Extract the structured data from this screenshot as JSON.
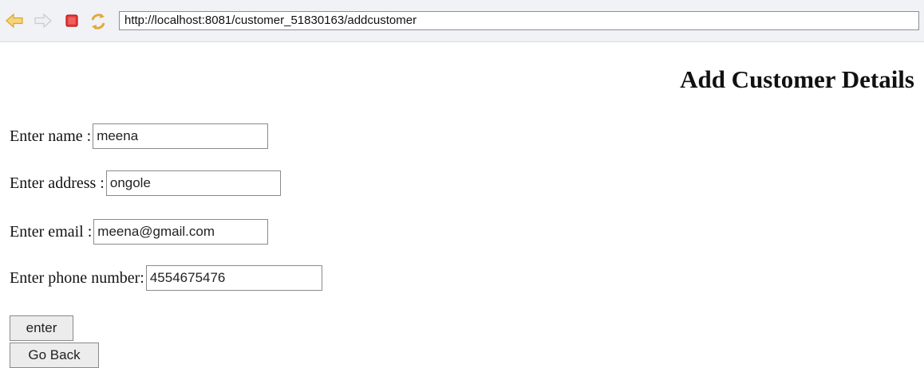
{
  "browser": {
    "url": "http://localhost:8081/customer_51830163/addcustomer",
    "icons": {
      "back": "back-arrow-icon",
      "forward": "forward-arrow-icon",
      "stop": "stop-icon",
      "refresh": "refresh-icon"
    }
  },
  "page": {
    "title": "Add Customer Details"
  },
  "form": {
    "name": {
      "label": "Enter name :",
      "value": "meena"
    },
    "address": {
      "label": "Enter address :",
      "value": "ongole"
    },
    "email": {
      "label": "Enter email :",
      "value": "meena@gmail.com"
    },
    "phone": {
      "label": "Enter phone number:",
      "value": "4554675476"
    }
  },
  "buttons": {
    "enter": "enter",
    "go_back": "Go Back"
  }
}
